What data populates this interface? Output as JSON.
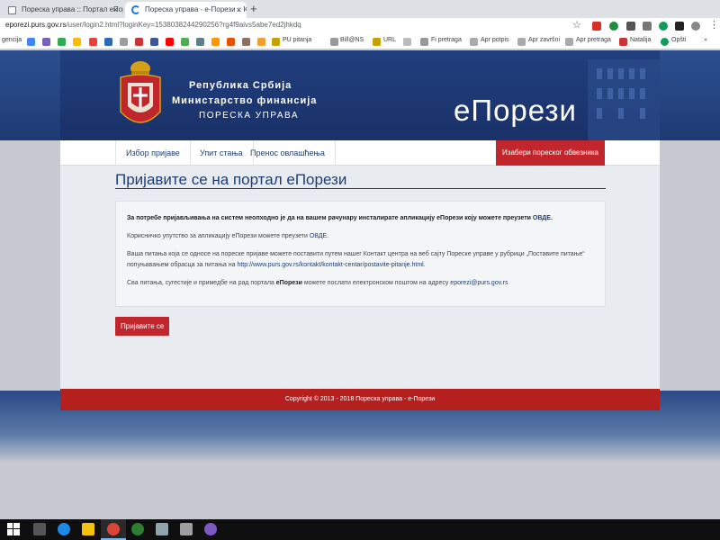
{
  "browser": {
    "tabs": [
      {
        "title": "Пореска управа :: Портал еПорези"
      },
      {
        "title": "Пореска управа - е-Порези :: Ка"
      }
    ],
    "new_tab": "+",
    "close": "×",
    "url_host": "eporezi.purs.gov.rs",
    "url_path": "/user/login2.html?loginKey=1538038244290256?rg4f9aivs5abe7ed2jhkdq",
    "bookmarks": [
      "gencija",
      "PU pitanja",
      "Bill@NS",
      "URL",
      "Fi pretraga",
      "Apr potpis",
      "Apr završni",
      "Apr pretraga",
      "Natalija",
      "Opšti"
    ]
  },
  "header": {
    "line1": "Република Србија",
    "line2": "Министарство финансија",
    "line3": "ПОРЕСКА УПРАВА",
    "brand": "еПорези"
  },
  "nav": {
    "items": [
      "Избор пријаве",
      "Упит стања",
      "Пренос овлашћења"
    ],
    "taxpayer_button": "Изабери пореског обвезника"
  },
  "main": {
    "title": "Пријавите се на портал еПорези",
    "p1_text": "За потребе пријављивања на систем неопходно је да на вашем рачунару инсталирате апликацију еПорези коју можете преузети ",
    "p1_link": "ОВДЕ",
    "p2_text": "Корисничко упутство за апликацију еПорези можете преузети ",
    "p2_link": "ОВДЕ",
    "p3_text": "Ваша питања која се односе на пореске пријаве можете поставити путем нашег Контакт центра на веб сајту Пореске управе у рубрици „Поставите питање“ попуњавањем обрасца за питања на ",
    "p3_link": "http://www.purs.gov.rs/kontakt/kontakt-centar/postavite-pitanje.html",
    "p4_text_a": "Сва питања, сугестије и примедбе на рад портала ",
    "p4_bold": "еПорези",
    "p4_text_b": " можете послати електронском поштом на адресу ",
    "p4_link": "eporezi@purs.gov.rs",
    "login_button": "Пријавите се"
  },
  "footer": {
    "copyright": "Copyright © 2013 - 2018 Пореска управа - е-Порези"
  },
  "colors": {
    "header_blue": "#1f3d75",
    "accent_red": "#c0262c",
    "footer_red": "#b5201f"
  }
}
